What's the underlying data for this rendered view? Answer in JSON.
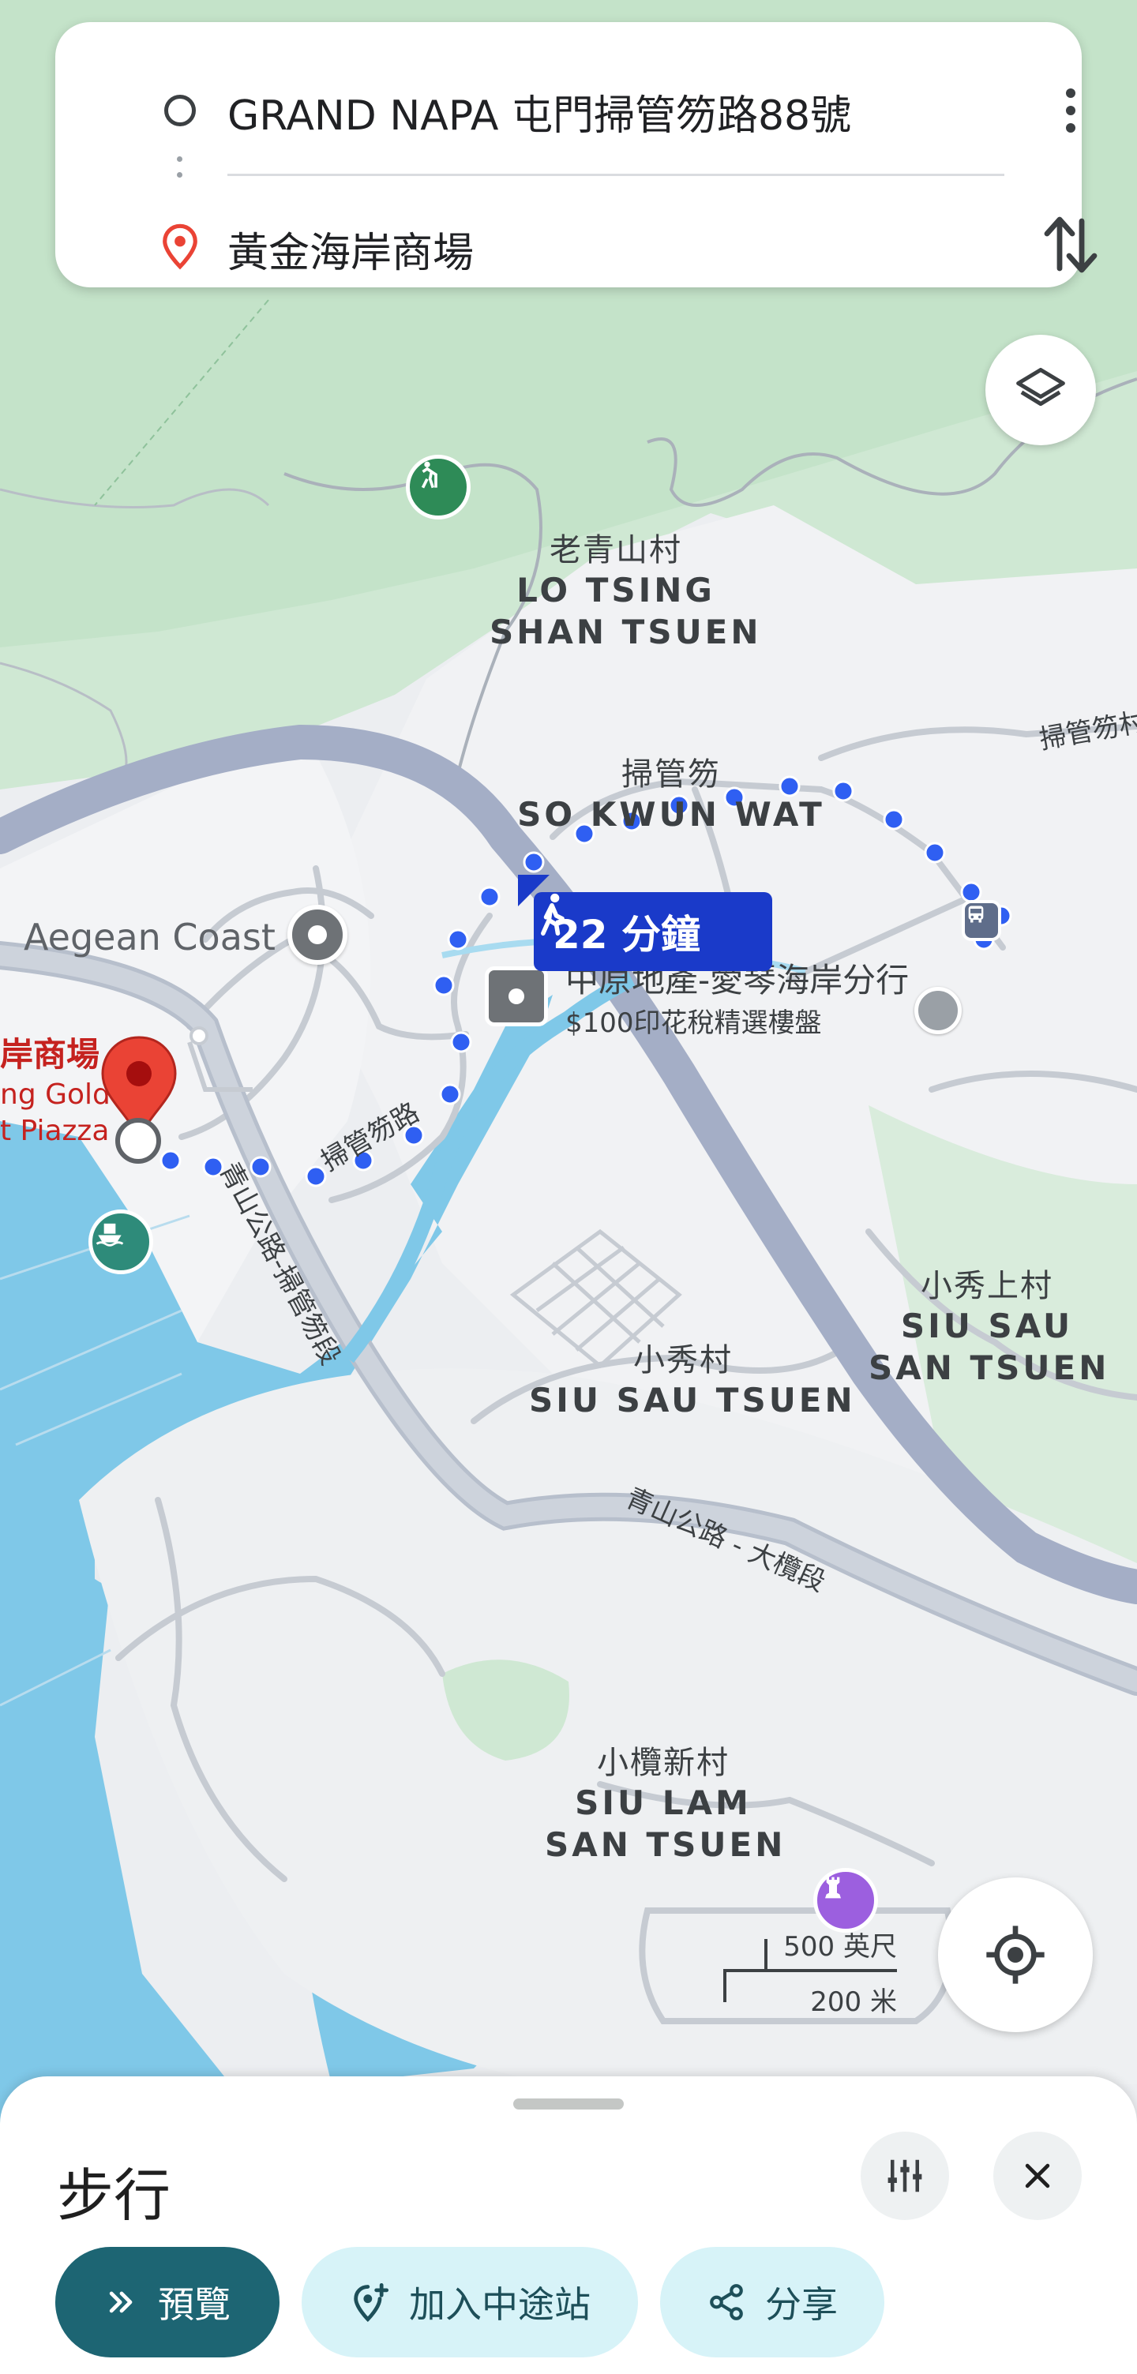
{
  "search": {
    "origin": "GRAND NAPA 屯門掃管笏路88號",
    "destination": "黃金海岸商場"
  },
  "map": {
    "labels": [
      {
        "zh": "老青山村",
        "en1": "LO TSING",
        "en2": "SHAN TSUEN"
      },
      {
        "zh": "掃管笏",
        "en1": "SO KWUN WAT",
        "en2": ""
      },
      {
        "zh": "小秀上村",
        "en1": "SIU SAU",
        "en2": "SAN TSUEN"
      },
      {
        "zh": "小秀村",
        "en1": "SIU SAU TSUEN",
        "en2": ""
      },
      {
        "zh": "小欖新村",
        "en1": "SIU LAM",
        "en2": "SAN TSUEN"
      }
    ],
    "roads": {
      "road1": "掃管笏路",
      "road2": "青山公路-掃管笏段",
      "road3": "青山公路 - 大欖段",
      "road4": "掃管笏村"
    },
    "aegean": "Aegean Coast",
    "dest_label_zh": "岸商場",
    "dest_label_en1": "ng Gold",
    "dest_label_en2": "t Piazza",
    "estate_agent_name": "中原地產-愛琴海岸分行",
    "estate_agent_promo": "$100印花稅精選樓盤"
  },
  "walk_badge": {
    "duration": "22 分鐘"
  },
  "scale": {
    "imperial": "500 英尺",
    "metric": "200 米"
  },
  "sheet": {
    "title": "步行",
    "preview_label": "預覽",
    "add_stop_label": "加入中途站",
    "share_label": "分享"
  },
  "colors": {
    "route_dot": "#2f5ff2",
    "badge": "#1a3ac9",
    "water": "#7fc8e8",
    "green": "#cfe8d3",
    "main_road": "#aab4cc",
    "preview_button": "#1d6573",
    "chip_bg": "#d7f3f8",
    "pin_red": "#ea4335"
  }
}
